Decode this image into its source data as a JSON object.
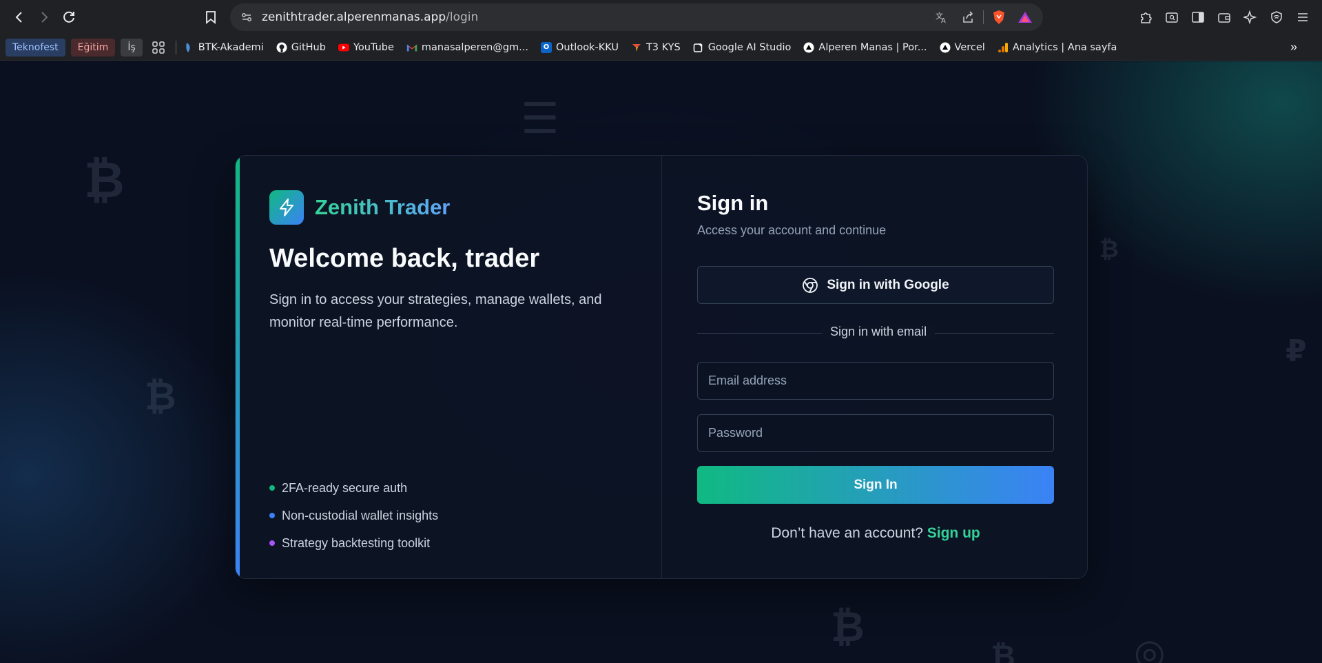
{
  "browser": {
    "url_host": "zenithtrader.alperenmanas.app",
    "url_path": "/login",
    "bookmark_folders": [
      {
        "label": "Teknofest",
        "color": "#9cc0ff"
      },
      {
        "label": "Eğitim",
        "color": "#f6a4a4"
      },
      {
        "label": "İş",
        "color": "#cfd2d6"
      }
    ],
    "bookmarks": [
      {
        "label": "BTK-Akademi",
        "icon": "btk-icon",
        "color": "#4a90d9"
      },
      {
        "label": "GitHub",
        "icon": "github-icon",
        "color": "#ffffff"
      },
      {
        "label": "YouTube",
        "icon": "youtube-icon",
        "color": "#ff0000"
      },
      {
        "label": "manasalperen@gm...",
        "icon": "gmail-icon",
        "color": "#ea4335"
      },
      {
        "label": "Outlook-KKU",
        "icon": "outlook-icon",
        "color": "#0a64c8"
      },
      {
        "label": "T3 KYS",
        "icon": "t3-icon",
        "color": "#e0503a"
      },
      {
        "label": "Google AI Studio",
        "icon": "ai-studio-icon",
        "color": "#ffffff"
      },
      {
        "label": "Alperen Manas | Por...",
        "icon": "vercel-icon",
        "color": "#ffffff"
      },
      {
        "label": "Vercel",
        "icon": "vercel-icon",
        "color": "#ffffff"
      },
      {
        "label": "Analytics | Ana sayfa",
        "icon": "analytics-icon",
        "color": "#f9ab00"
      }
    ]
  },
  "brand": {
    "name": "Zenith Trader",
    "icon": "lightning-icon"
  },
  "hero": {
    "title": "Welcome back, trader",
    "subtitle": "Sign in to access your strategies, manage wallets, and monitor real-time performance."
  },
  "features": [
    {
      "label": "2FA-ready secure auth",
      "color": "#10b981"
    },
    {
      "label": "Non-custodial wallet insights",
      "color": "#3b82f6"
    },
    {
      "label": "Strategy backtesting toolkit",
      "color": "#a855f7"
    }
  ],
  "signin": {
    "title": "Sign in",
    "subtitle": "Access your account and continue",
    "google_label": "Sign in with Google",
    "divider_label": "Sign in with email",
    "email_placeholder": "Email address",
    "password_placeholder": "Password",
    "submit_label": "Sign In",
    "signup_prompt": "Don’t have an account?",
    "signup_link": "Sign up"
  },
  "background_glyphs": [
    "₿",
    "₿",
    "₿",
    "₽",
    "₿",
    "₿",
    "☰",
    "◎"
  ],
  "colors": {
    "accent_green": "#10b981",
    "accent_blue": "#3b82f6",
    "page_bg": "#0a1020"
  }
}
